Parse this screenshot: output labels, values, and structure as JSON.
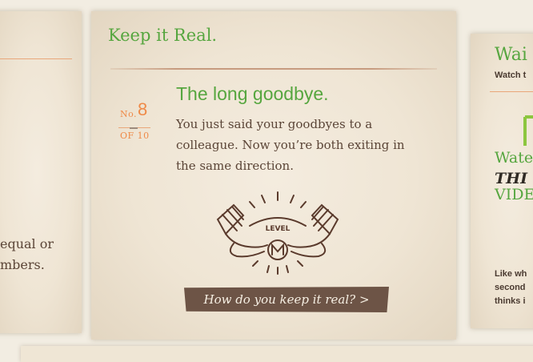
{
  "left_card": {
    "lines": [
      "equal or",
      "mbers."
    ]
  },
  "main_card": {
    "heading": "Keep it Real.",
    "badge": {
      "prefix": "No.",
      "number": "8",
      "of_label": "OF 10"
    },
    "item_title": "The long goodbye.",
    "description_lines": [
      "You just said your goodbyes to a",
      "colleague. Now you’re both exiting in",
      "the same direction."
    ],
    "illustration": {
      "label": "LEVEL",
      "icon": "level-illustration-icon"
    },
    "cta_label": "How do you keep it real? >"
  },
  "right_card": {
    "title": "Wai",
    "subtitle": "Watch t",
    "big_lines": [
      "Wate",
      "THI",
      "VIDE"
    ],
    "small_lines": [
      "Like wh",
      "second",
      "thinks i"
    ]
  },
  "colors": {
    "accent_green": "#56a63f",
    "accent_orange": "#ef8a48",
    "text_brown": "#5b4537",
    "button_brown": "#6d5446",
    "card_bg": "#efe5d4"
  }
}
